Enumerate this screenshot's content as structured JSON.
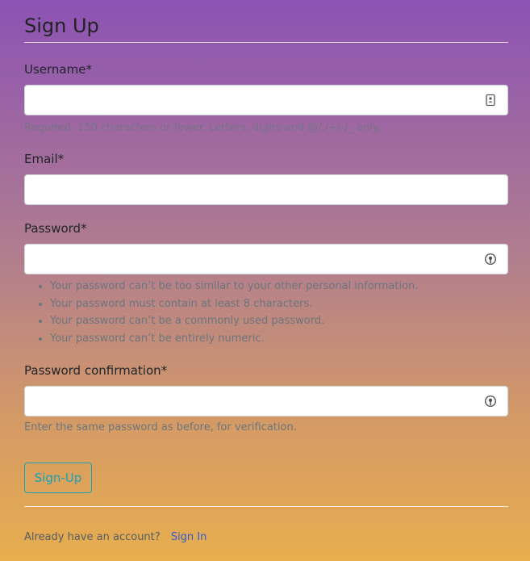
{
  "page": {
    "title": "Sign Up"
  },
  "form": {
    "username": {
      "label": "Username*",
      "value": "",
      "placeholder": "",
      "help": "Required. 150 characters or fewer. Letters, digits and @/./+/-/_ only."
    },
    "email": {
      "label": "Email*",
      "value": "",
      "placeholder": ""
    },
    "password": {
      "label": "Password*",
      "value": "",
      "placeholder": "",
      "help_items": [
        "Your password can’t be too similar to your other personal information.",
        "Your password must contain at least 8 characters.",
        "Your password can’t be a commonly used password.",
        "Your password can’t be entirely numeric."
      ]
    },
    "password_confirmation": {
      "label": "Password confirmation*",
      "value": "",
      "placeholder": "",
      "help": "Enter the same password as before, for verification."
    },
    "submit_label": "Sign-Up"
  },
  "footer": {
    "prompt": "Already have an account?",
    "signin_link": "Sign In"
  },
  "colors": {
    "accent": "#17a2b8",
    "link": "#2f5bd1",
    "gradient_top": "#8c52b4",
    "gradient_bottom": "#e8ae4e"
  },
  "icons": {
    "username_field": "contact-card-icon",
    "password_field": "password-key-icon",
    "password_confirmation_field": "password-key-icon"
  }
}
